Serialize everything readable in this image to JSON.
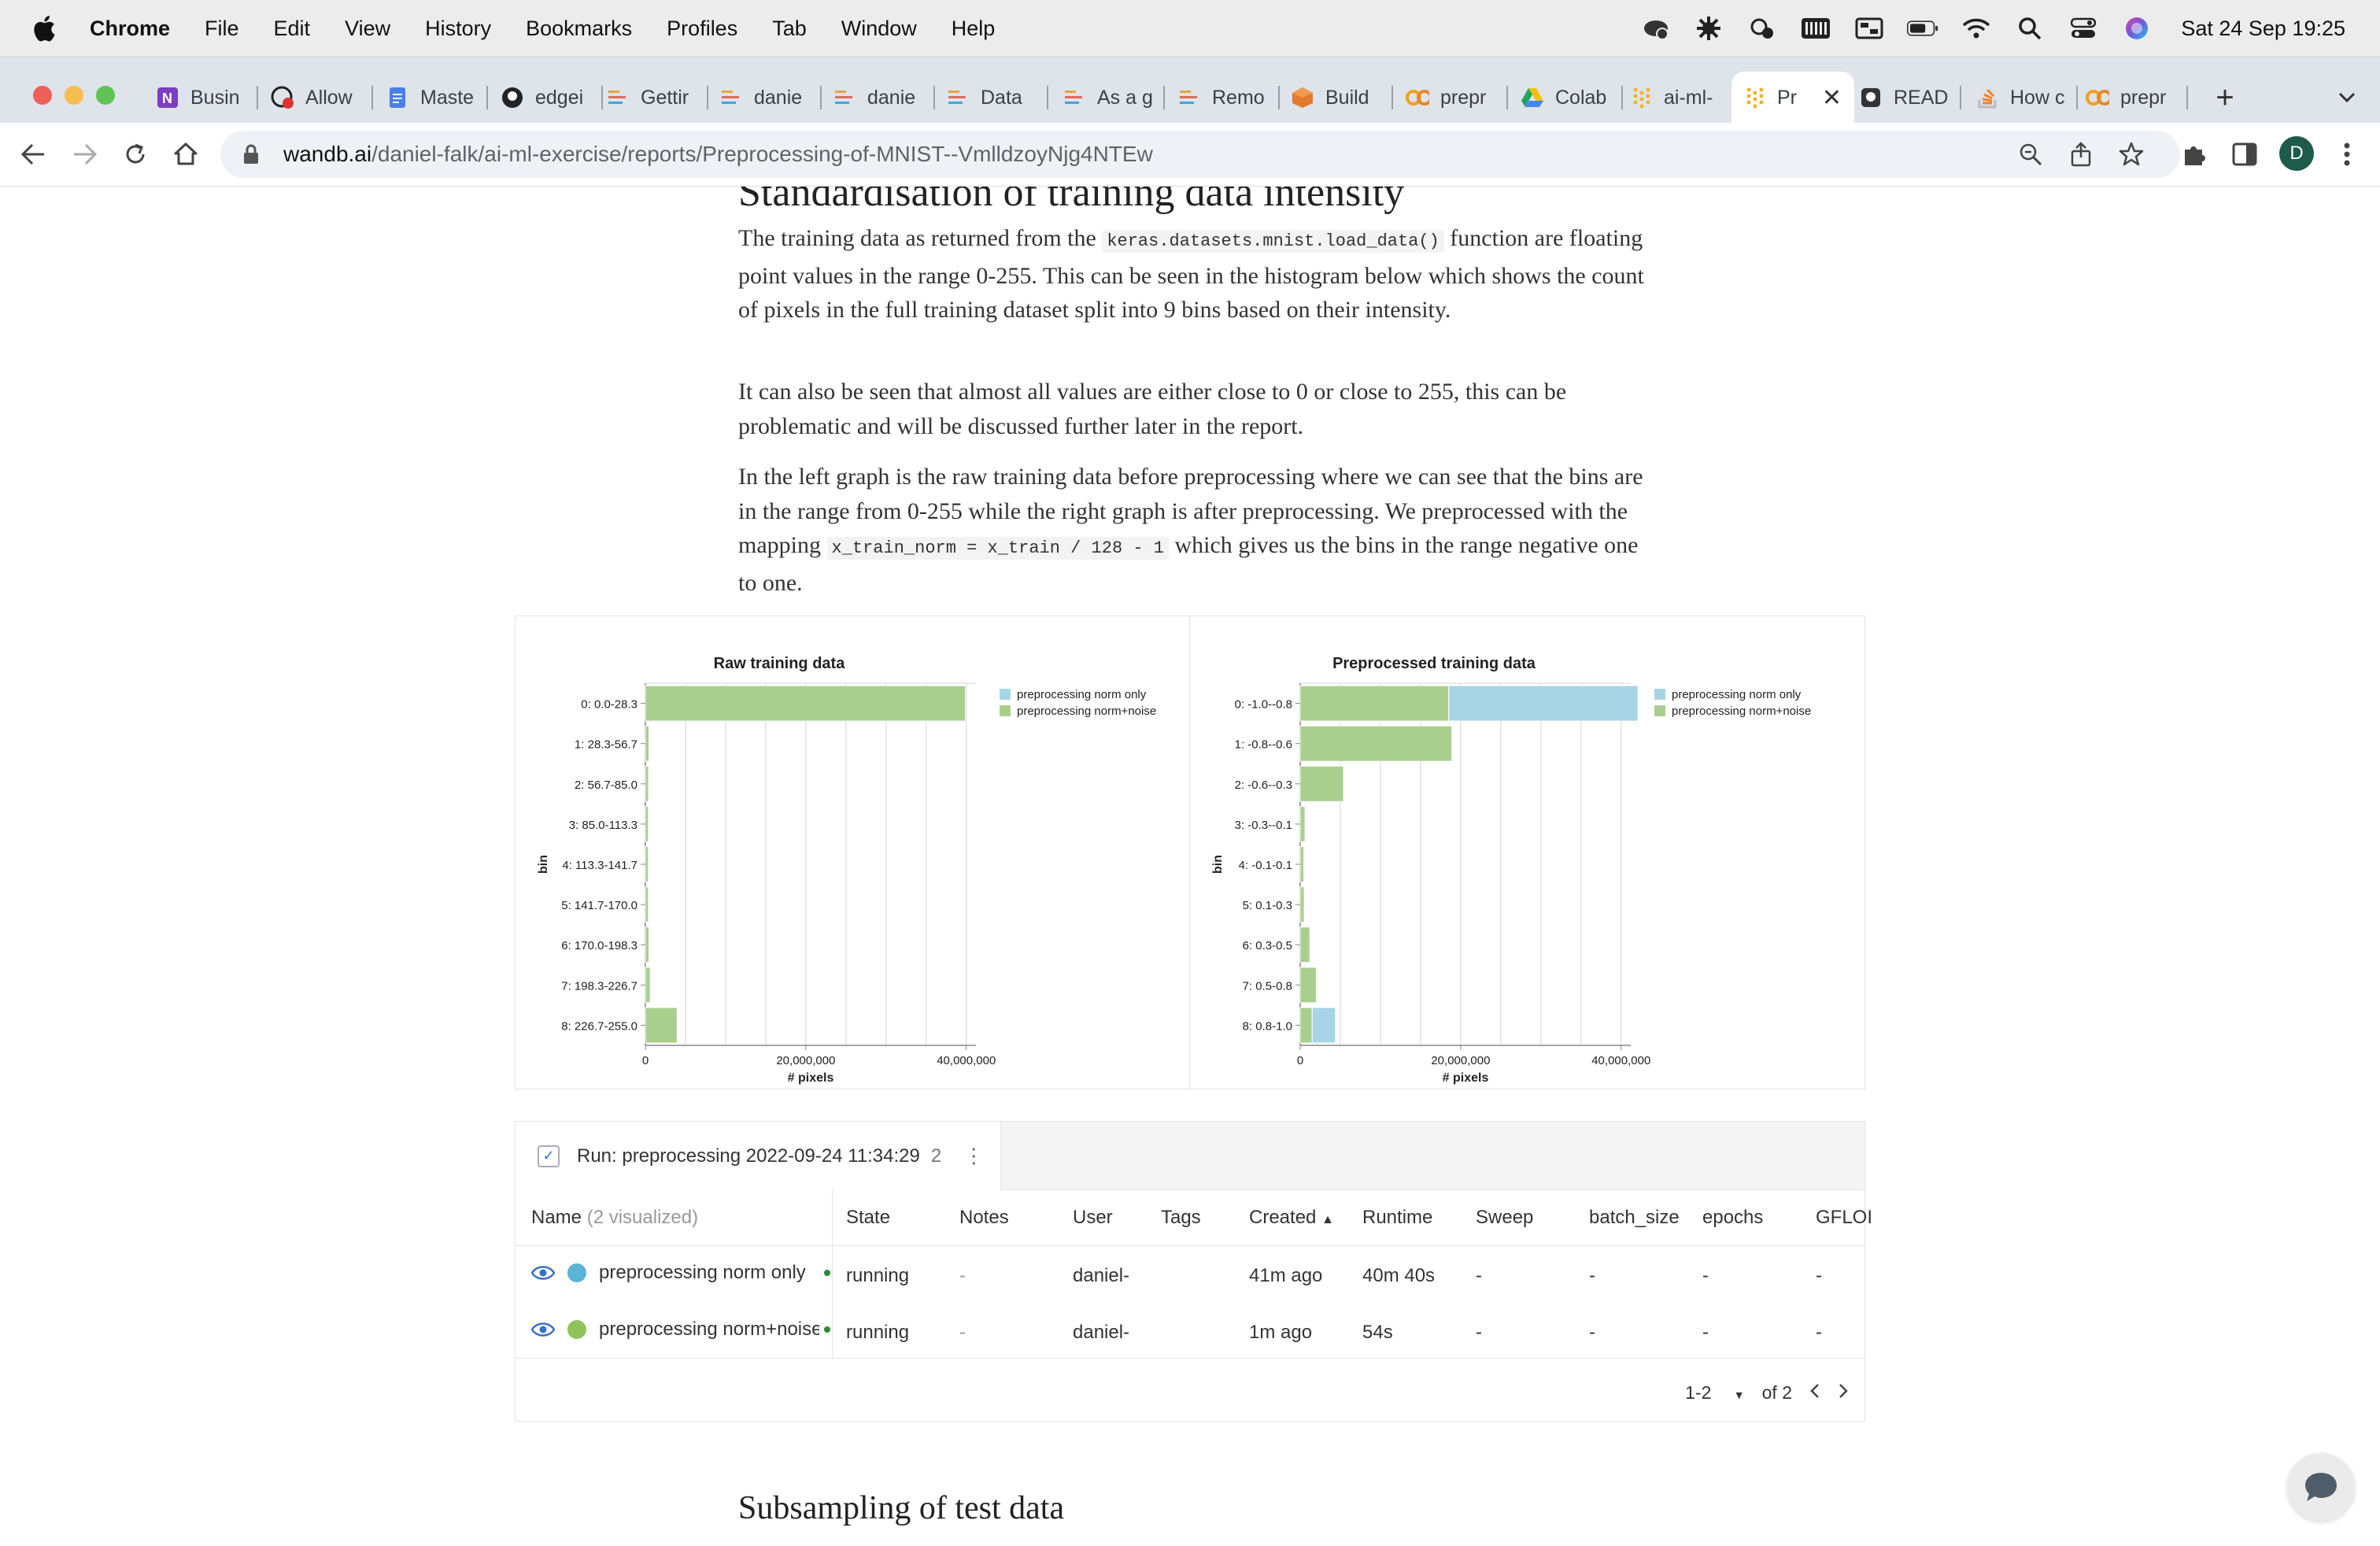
{
  "menubar": {
    "app": "Chrome",
    "items": [
      "File",
      "Edit",
      "View",
      "History",
      "Bookmarks",
      "Profiles",
      "Tab",
      "Window",
      "Help"
    ],
    "clock": "Sat 24 Sep  19:25"
  },
  "tabs": [
    {
      "label": "Busin",
      "icon": "onenote-icon"
    },
    {
      "label": "Allow",
      "icon": "github-x-icon"
    },
    {
      "label": "Maste",
      "icon": "docs-icon"
    },
    {
      "label": "edgei",
      "icon": "github-icon"
    },
    {
      "label": "Gettir",
      "icon": "wandb-icon"
    },
    {
      "label": "danie",
      "icon": "wandb-icon"
    },
    {
      "label": "danie",
      "icon": "wandb-icon"
    },
    {
      "label": "Data",
      "icon": "wandb-icon"
    },
    {
      "label": "As a g",
      "icon": "wandb-icon"
    },
    {
      "label": "Remo",
      "icon": "wandb-icon"
    },
    {
      "label": "Build",
      "icon": "box-icon"
    },
    {
      "label": "prepr",
      "icon": "colab-icon"
    },
    {
      "label": "Colab",
      "icon": "drive-icon"
    },
    {
      "label": "ai-ml-",
      "icon": "wandb-dots-icon"
    },
    {
      "label": "Pr",
      "icon": "wandb-dots-icon"
    },
    {
      "label": "READ",
      "icon": "github-icon"
    },
    {
      "label": "How c",
      "icon": "stackoverflow-icon"
    },
    {
      "label": "prepr",
      "icon": "colab-icon"
    }
  ],
  "toolbar": {
    "url_host": "wandb.ai",
    "url_path": "/daniel-falk/ai-ml-exercise/reports/Preprocessing-of-MNIST--VmlldzoyNjg4NTEw",
    "avatar_letter": "D"
  },
  "article": {
    "heading_partial": "Standardisation of training data intensity",
    "p1_a": "The training data as returned from the ",
    "p1_code": "keras.datasets.mnist.load_data()",
    "p1_b": " function are floating point values in the range 0-255. This can be seen in the histogram below which shows the count of pixels in the full training dataset split into 9 bins based on their intensity.",
    "p2": "It can also be seen that almost all values are either close to 0 or close to 255, this can be problematic and will be discussed further later in the report.",
    "p3_a": "In the left graph is the raw training data before preprocessing where we can see that the bins are in the range from 0-255 while the right graph is after preprocessing. We preprocessed with the mapping ",
    "p3_code": "x_train_norm = x_train / 128 - 1",
    "p3_b": " which gives us the bins in the range negative one to one.",
    "subheading": "Subsampling of test data"
  },
  "chart_data": [
    {
      "type": "bar",
      "orientation": "horizontal",
      "stacked": true,
      "title": "Raw training data",
      "xlabel": "# pixels",
      "ylabel": "bin",
      "xlim": [
        0,
        40000000
      ],
      "x_ticks": [
        "0",
        "20,000,000",
        "40,000,000"
      ],
      "grid": true,
      "legend_position": "right",
      "categories": [
        "0: 0.0-28.3",
        "1: 28.3-56.7",
        "2: 56.7-85.0",
        "3: 85.0-113.3",
        "4: 113.3-141.7",
        "5: 141.7-170.0",
        "6: 170.0-198.3",
        "7: 198.3-226.7",
        "8: 226.7-255.0"
      ],
      "series": [
        {
          "name": "preprocessing norm only",
          "color": "#a8d5e5",
          "values": [
            0,
            0,
            0,
            0,
            0,
            0,
            0,
            0,
            0
          ]
        },
        {
          "name": "preprocessing norm+noise",
          "color": "#a9cf8f",
          "values": [
            39900000,
            450000,
            400000,
            380000,
            370000,
            380000,
            450000,
            600000,
            3950000
          ]
        }
      ]
    },
    {
      "type": "bar",
      "orientation": "horizontal",
      "stacked": true,
      "title": "Preprocessed training data",
      "xlabel": "# pixels",
      "ylabel": "bin",
      "xlim": [
        0,
        40000000
      ],
      "x_ticks": [
        "0",
        "20,000,000",
        "40,000,000"
      ],
      "grid": true,
      "legend_position": "right",
      "categories": [
        "0: -1.0--0.8",
        "1: -0.8--0.6",
        "2: -0.6--0.3",
        "3: -0.3--0.1",
        "4: -0.1-0.1",
        "5: 0.1-0.3",
        "6: 0.3-0.5",
        "7: 0.5-0.8",
        "8: 0.8-1.0"
      ],
      "series": [
        {
          "name": "preprocessing norm+noise",
          "color": "#a9cf8f",
          "values": [
            18500000,
            18900000,
            5400000,
            600000,
            450000,
            500000,
            1200000,
            2000000,
            1500000
          ]
        },
        {
          "name": "preprocessing norm only",
          "color": "#a8d5e5",
          "values": [
            23600000,
            0,
            0,
            0,
            0,
            0,
            0,
            0,
            2900000
          ]
        }
      ]
    }
  ],
  "runs_table": {
    "tab_title": "Run: preprocessing 2022-09-24 11:34:29",
    "tab_count": "2",
    "columns": {
      "name": "Name",
      "name_note": "(2 visualized)",
      "state": "State",
      "notes": "Notes",
      "user": "User",
      "tags": "Tags",
      "created": "Created",
      "runtime": "Runtime",
      "sweep": "Sweep",
      "batch_size": "batch_size",
      "epochs": "epochs",
      "gflops": "GFLOI"
    },
    "rows": [
      {
        "name": "preprocessing norm only",
        "color": "#5ab4d6",
        "state": "running",
        "notes": "-",
        "user": "daniel-",
        "created": "41m ago",
        "runtime": "40m 40s",
        "sweep": "-",
        "batch_size": "-",
        "epochs": "-",
        "gflops": "-"
      },
      {
        "name": "preprocessing norm+noise",
        "color": "#8fc45a",
        "state": "running",
        "notes": "-",
        "user": "daniel-",
        "created": "1m ago",
        "runtime": "54s",
        "sweep": "-",
        "batch_size": "-",
        "epochs": "-",
        "gflops": "-"
      }
    ],
    "pager": {
      "range": "1-2",
      "of": "of 2"
    }
  }
}
